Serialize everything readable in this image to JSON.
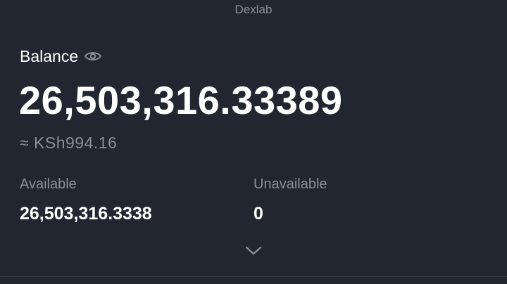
{
  "header": {
    "app_label": "Dexlab"
  },
  "balance": {
    "title": "Balance",
    "amount": "26,503,316.33389",
    "fiat_approx": "≈ KSh994.16"
  },
  "breakdown": {
    "available_label": "Available",
    "available_value": "26,503,316.3338",
    "unavailable_label": "Unavailable",
    "unavailable_value": "0"
  },
  "icons": {
    "visibility": "eye-icon",
    "expand": "chevron-down-icon"
  },
  "colors": {
    "background": "#212630",
    "primary_text": "#ffffff",
    "secondary_text": "#8a8f99",
    "divider": "#343a46"
  }
}
